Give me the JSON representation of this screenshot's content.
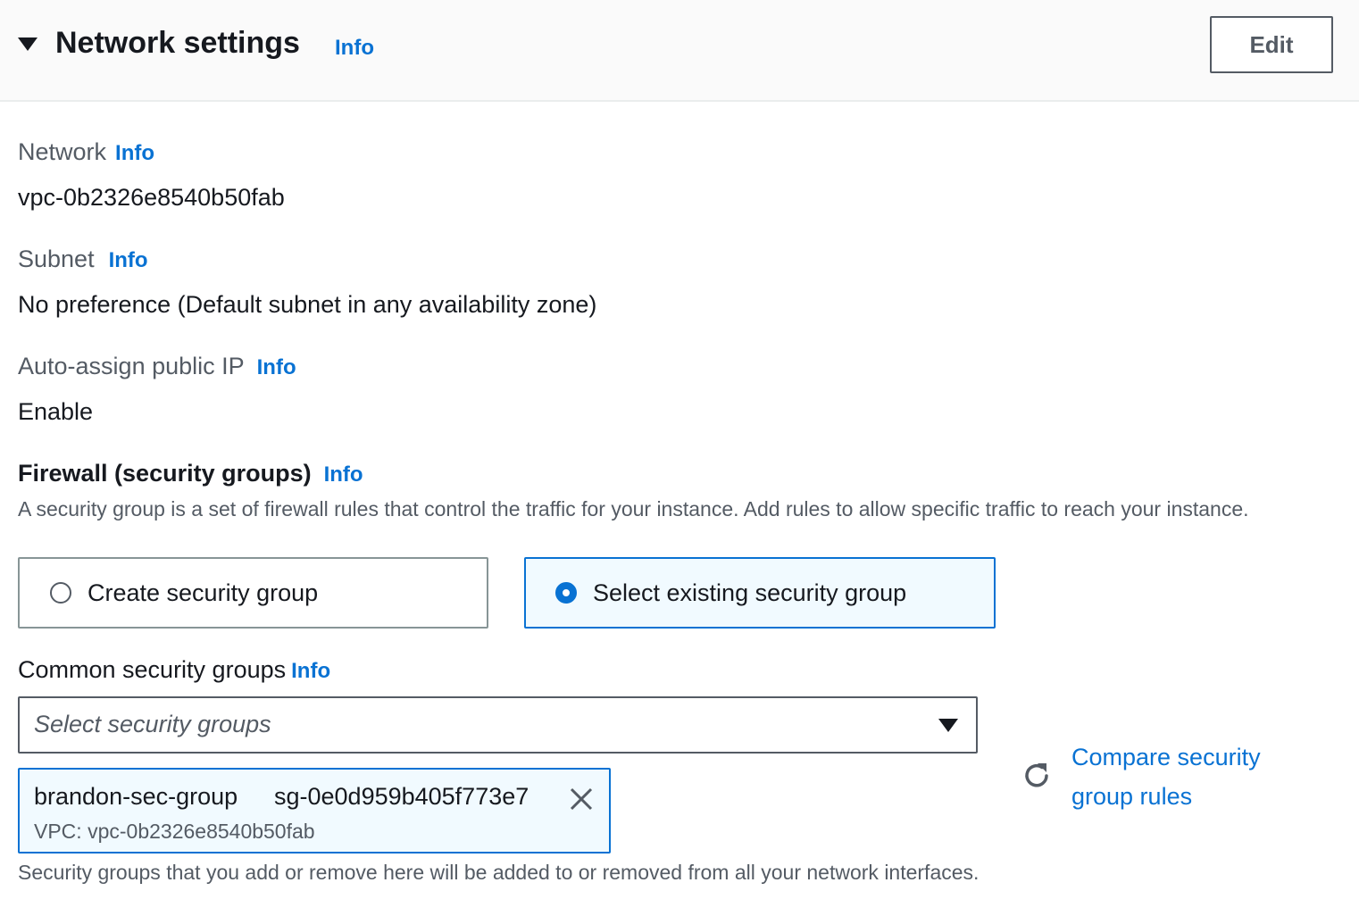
{
  "header": {
    "title": "Network settings",
    "info": "Info",
    "edit_label": "Edit"
  },
  "network": {
    "label": "Network",
    "info": "Info",
    "value": "vpc-0b2326e8540b50fab"
  },
  "subnet": {
    "label": "Subnet",
    "info": "Info",
    "value": "No preference (Default subnet in any availability zone)"
  },
  "public_ip": {
    "label": "Auto-assign public IP",
    "info": "Info",
    "value": "Enable"
  },
  "firewall": {
    "label": "Firewall (security groups)",
    "info": "Info",
    "description": "A security group is a set of firewall rules that control the traffic for your instance. Add rules to allow specific traffic to reach your instance.",
    "options": [
      {
        "label": "Create security group",
        "selected": false
      },
      {
        "label": "Select existing security group",
        "selected": true
      }
    ]
  },
  "common_groups": {
    "label": "Common security groups",
    "info": "Info",
    "placeholder": "Select security groups",
    "selected_token": {
      "name": "brandon-sec-group",
      "id": "sg-0e0d959b405f773e7",
      "vpc": "VPC: vpc-0b2326e8540b50fab"
    },
    "compare_link": "Compare security group rules",
    "note": "Security groups that you add or remove here will be added to or removed from all your network interfaces."
  },
  "colors": {
    "accent": "#0972d3",
    "text": "#16191f",
    "secondary": "#545b64",
    "selected_bg": "#f1faff"
  },
  "icons": [
    "caret-down-icon",
    "radio-icon",
    "dropdown-caret-icon",
    "close-icon",
    "refresh-icon"
  ]
}
